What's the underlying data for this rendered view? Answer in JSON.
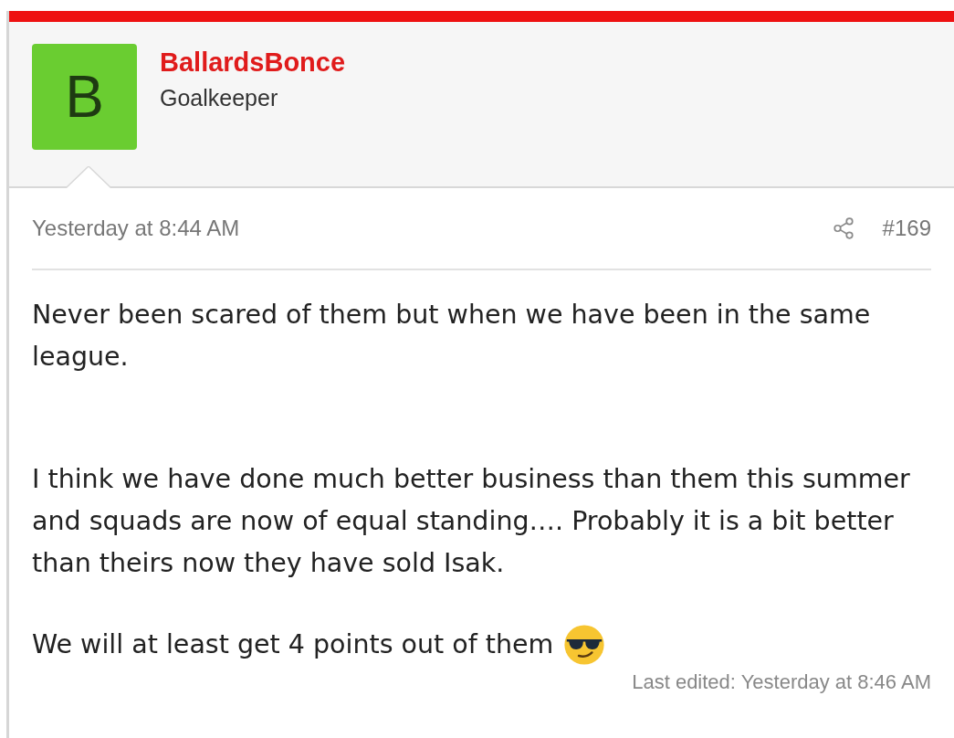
{
  "post": {
    "author": {
      "initial": "B",
      "name": "BallardsBonce",
      "title": "Goalkeeper"
    },
    "date": "Yesterday at 8:44 AM",
    "number": "#169",
    "paragraphs": [
      {
        "kind": "text",
        "text": "Never been scared of them but when we have been in the same league."
      },
      {
        "kind": "text",
        "text": "I think we have done much better business than them this summer and squads are now of equal standing…. Probably it is a bit better than theirs now they have sold Isak."
      },
      {
        "kind": "text_with_emoji",
        "text": "We will at least get 4 points out of them"
      }
    ],
    "last_edited": "Last edited: Yesterday at 8:46 AM"
  }
}
